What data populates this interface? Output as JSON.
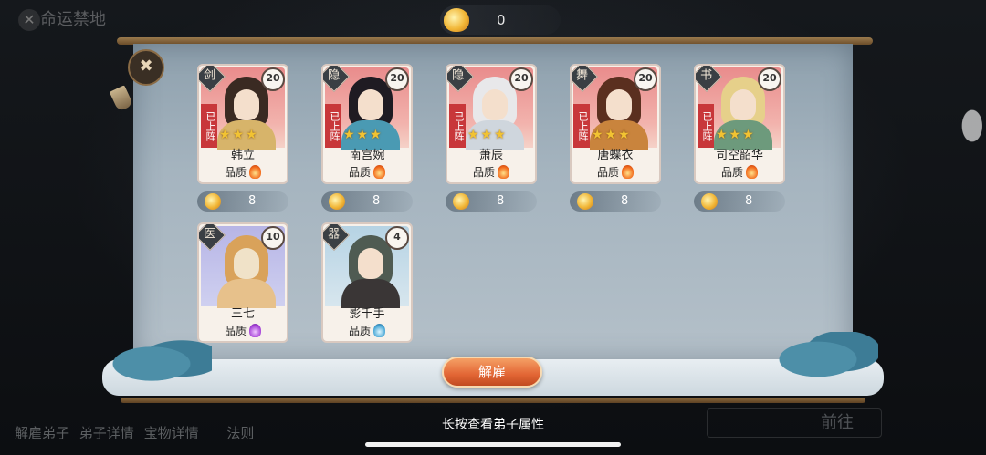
{
  "header": {
    "title": "命运禁地",
    "currency_value": "0"
  },
  "characters": [
    {
      "name": "韩立",
      "faction": "剑",
      "level": "20",
      "deployed_label": "已上阵",
      "stars": "★★★",
      "quality_label": "品质",
      "quality_color": "#f26a1b",
      "hire_cost": "8",
      "card_theme": "red"
    },
    {
      "name": "南宫婉",
      "faction": "隐",
      "level": "20",
      "deployed_label": "已上阵",
      "stars": "★★★",
      "quality_label": "品质",
      "quality_color": "#f26a1b",
      "hire_cost": "8",
      "card_theme": "red"
    },
    {
      "name": "萧辰",
      "faction": "隐",
      "level": "20",
      "deployed_label": "已上阵",
      "stars": "★★★",
      "quality_label": "品质",
      "quality_color": "#f26a1b",
      "hire_cost": "8",
      "card_theme": "red"
    },
    {
      "name": "唐蝶衣",
      "faction": "舞",
      "level": "20",
      "deployed_label": "已上阵",
      "stars": "★★★",
      "quality_label": "品质",
      "quality_color": "#f26a1b",
      "hire_cost": "8",
      "card_theme": "red"
    },
    {
      "name": "司空韶华",
      "faction": "书",
      "level": "20",
      "deployed_label": "已上阵",
      "stars": "★★★",
      "quality_label": "品质",
      "quality_color": "#f26a1b",
      "hire_cost": "8",
      "card_theme": "red"
    },
    {
      "name": "三七",
      "faction": "医",
      "level": "10",
      "quality_label": "品质",
      "quality_color": "#a745d8",
      "card_theme": "purple"
    },
    {
      "name": "影千手",
      "faction": "器",
      "level": "4",
      "quality_label": "品质",
      "quality_color": "#49a7d6",
      "card_theme": "blue"
    }
  ],
  "actions": {
    "dismiss_label": "解雇",
    "hint_text": "长按查看弟子属性"
  },
  "bottom_tabs": [
    "解雇弟子",
    "弟子详情",
    "宝物详情",
    "法则"
  ],
  "bottom_right_label": "前往"
}
